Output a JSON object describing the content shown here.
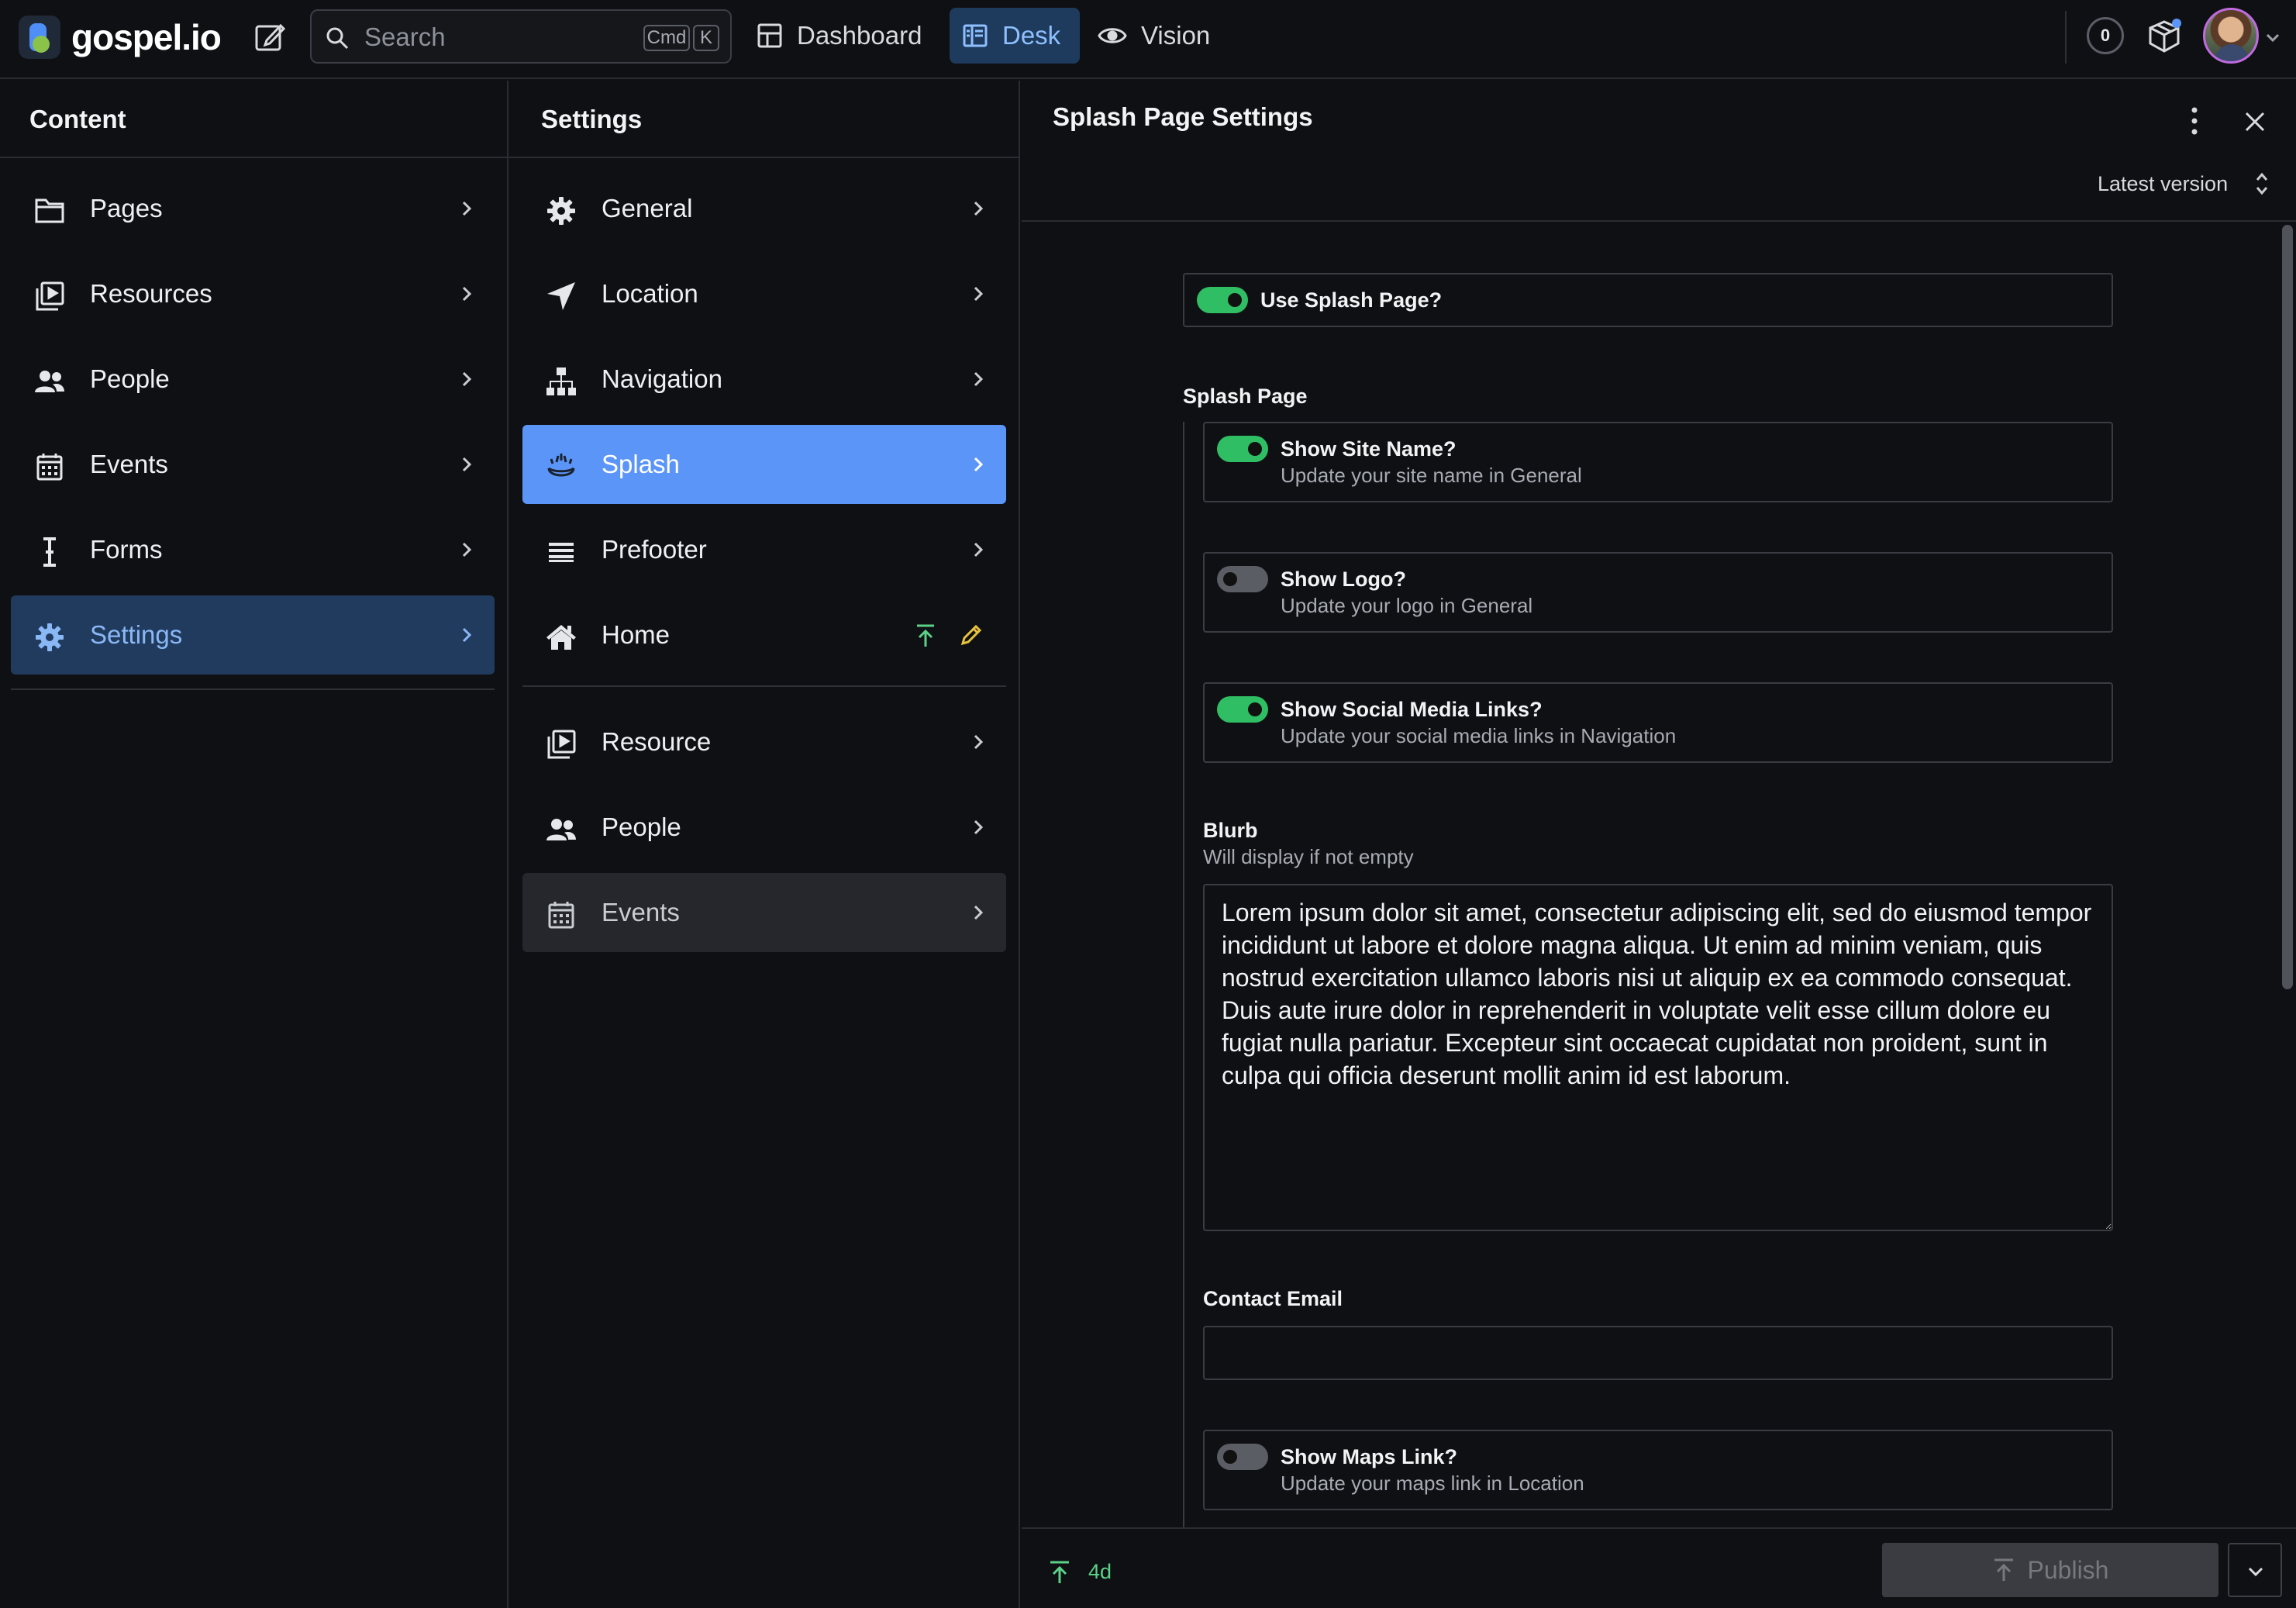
{
  "brand": {
    "name": "gospel.io"
  },
  "topbar": {
    "search_placeholder": "Search",
    "shortcut_cmd": "Cmd",
    "shortcut_key": "K",
    "tabs": [
      {
        "label": "Dashboard"
      },
      {
        "label": "Desk"
      },
      {
        "label": "Vision"
      }
    ],
    "notification_count": "0"
  },
  "content_col": {
    "title": "Content",
    "items": [
      {
        "label": "Pages",
        "icon": "folder-icon"
      },
      {
        "label": "Resources",
        "icon": "media-library-icon"
      },
      {
        "label": "People",
        "icon": "people-icon"
      },
      {
        "label": "Events",
        "icon": "calendar-icon"
      },
      {
        "label": "Forms",
        "icon": "text-cursor-icon"
      },
      {
        "label": "Settings",
        "icon": "gear-icon"
      }
    ]
  },
  "settings_col": {
    "title": "Settings",
    "items": [
      {
        "label": "General",
        "icon": "gear-icon"
      },
      {
        "label": "Location",
        "icon": "location-arrow-icon"
      },
      {
        "label": "Navigation",
        "icon": "sitemap-icon"
      },
      {
        "label": "Splash",
        "icon": "splash-icon"
      },
      {
        "label": "Prefooter",
        "icon": "list-icon"
      },
      {
        "label": "Home",
        "icon": "home-icon"
      },
      {
        "label": "Resource",
        "icon": "media-library-icon"
      },
      {
        "label": "People",
        "icon": "people-icon"
      },
      {
        "label": "Events",
        "icon": "calendar-icon"
      }
    ]
  },
  "panel": {
    "title": "Splash Page Settings",
    "version_label": "Latest version",
    "use_splash": {
      "label": "Use Splash Page?",
      "on": true
    },
    "group_label": "Splash Page",
    "show_site_name": {
      "label": "Show Site Name?",
      "help": "Update your site name in General",
      "on": true
    },
    "show_logo": {
      "label": "Show Logo?",
      "help": "Update your logo in General",
      "on": false
    },
    "show_social": {
      "label": "Show Social Media Links?",
      "help": "Update your social media links in Navigation",
      "on": true
    },
    "blurb": {
      "label": "Blurb",
      "help": "Will display if not empty",
      "value": "Lorem ipsum dolor sit amet, consectetur adipiscing elit, sed do eiusmod tempor incididunt ut labore et dolore magna aliqua. Ut enim ad minim veniam, quis nostrud exercitation ullamco laboris nisi ut aliquip ex ea commodo consequat. Duis aute irure dolor in reprehenderit in voluptate velit esse cillum dolore eu fugiat nulla pariatur. Excepteur sint occaecat cupidatat non proident, sunt in culpa qui officia deserunt mollit anim id est laborum."
    },
    "contact_email": {
      "label": "Contact Email",
      "value": ""
    },
    "show_maps": {
      "label": "Show Maps Link?",
      "help": "Update your maps link in Location",
      "on": false
    }
  },
  "footer": {
    "version_age": "4d",
    "publish_label": "Publish"
  },
  "colors": {
    "accent_blue": "#5b95f7",
    "toggle_on": "#2fbe63",
    "success_text": "#5bd187"
  }
}
